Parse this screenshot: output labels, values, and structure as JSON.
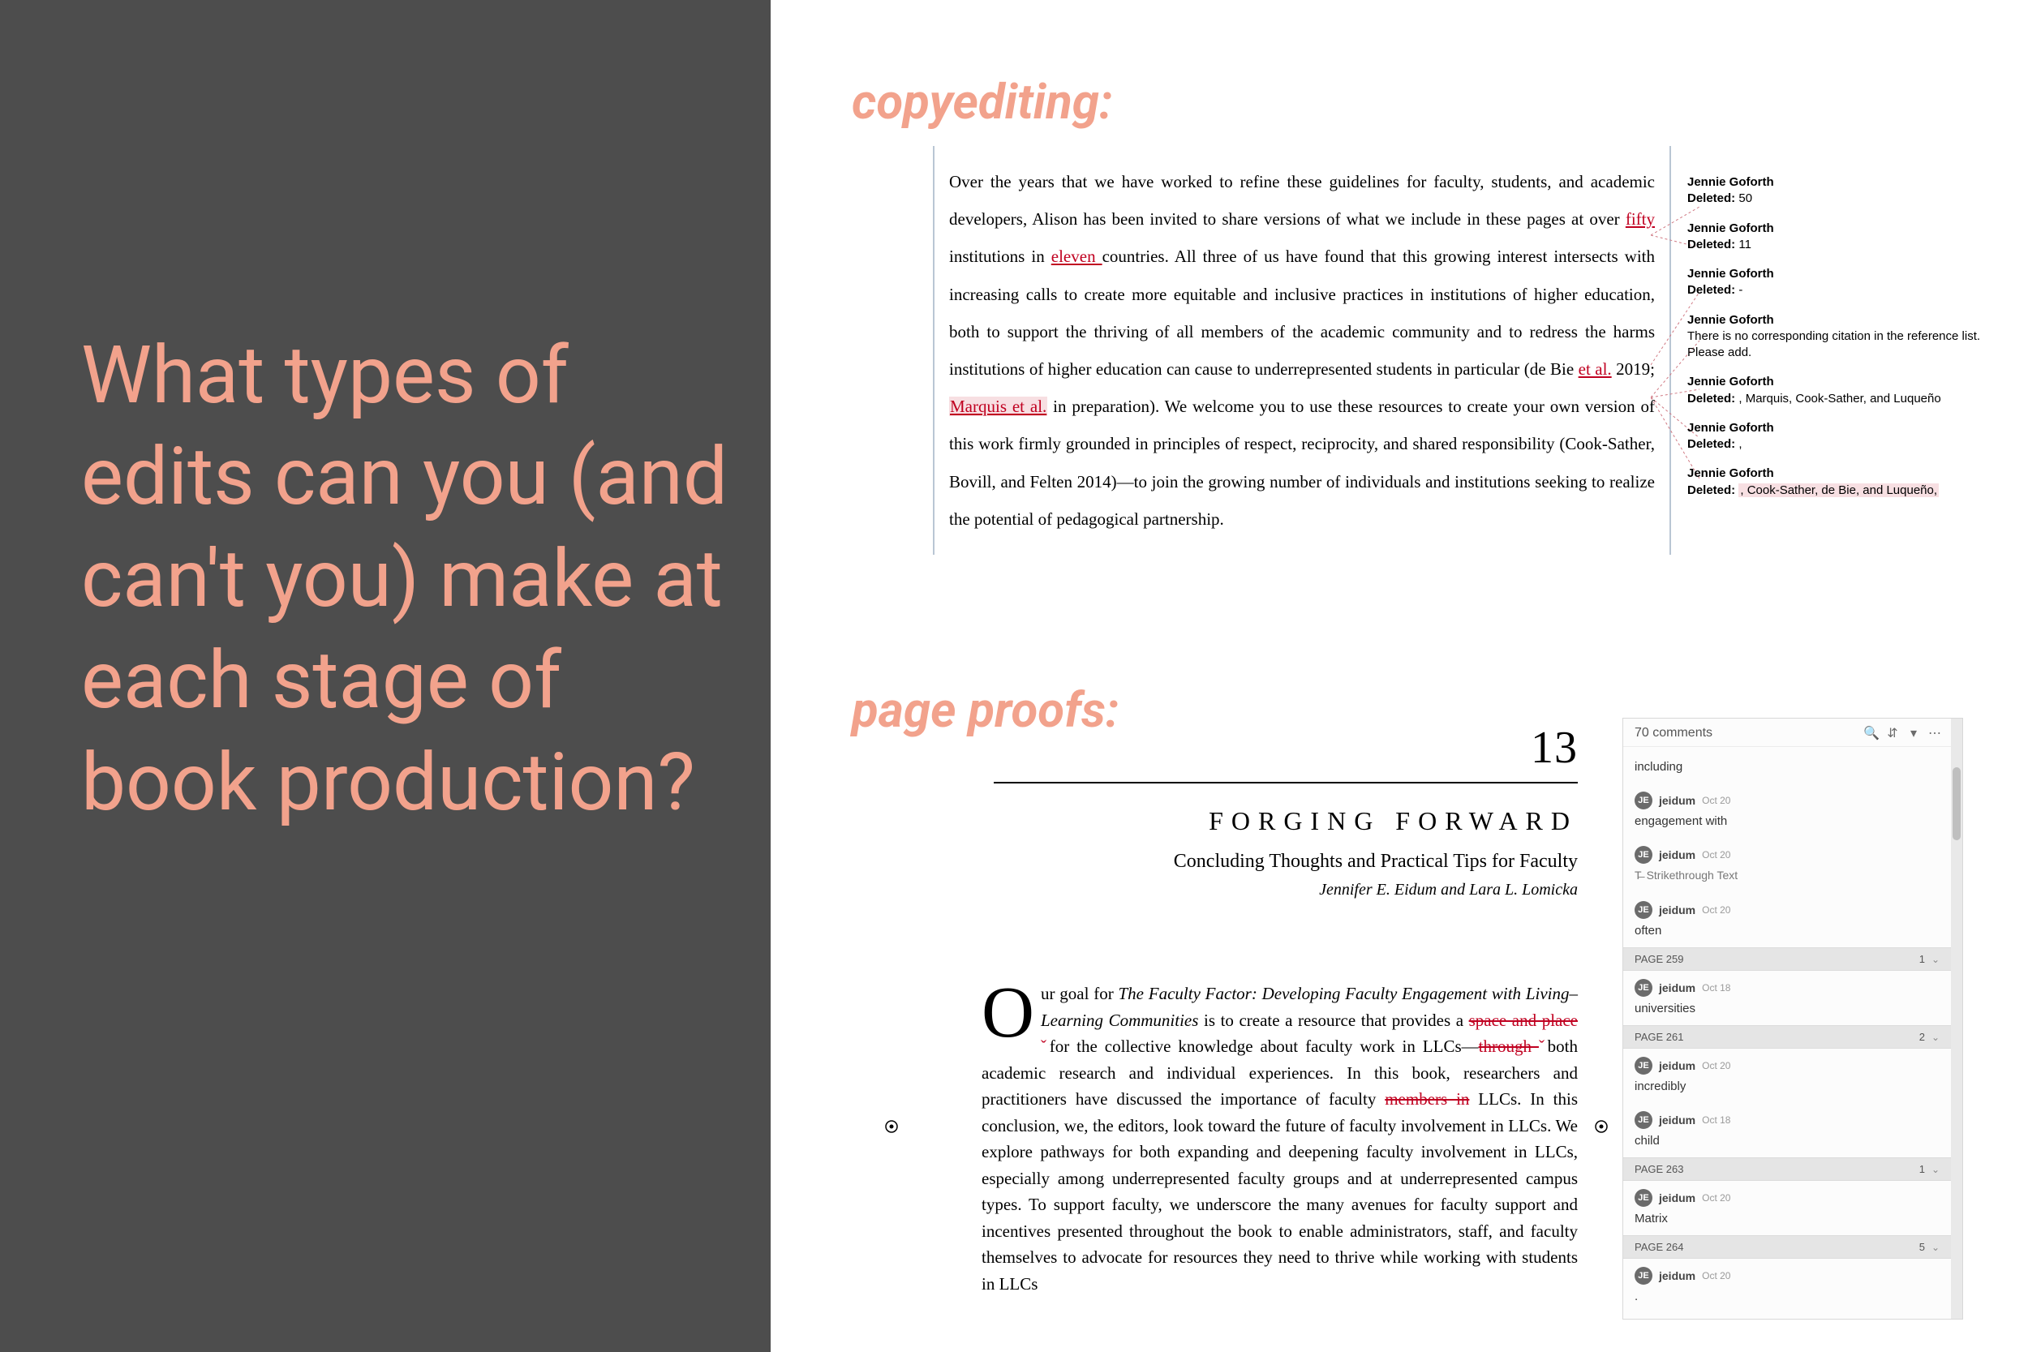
{
  "left": {
    "question": "What types of edits can you (and can't you) make at each stage of book production?"
  },
  "labels": {
    "copyediting": "copyediting:",
    "page_proofs": "page proofs:"
  },
  "manuscript": {
    "lead": "Over the years that we have worked to refine these guidelines for faculty, students, and academic developers, Alison has been invited to share versions of what we include in these pages at over ",
    "t1": "fifty ",
    "mid1": "institutions in ",
    "t2": "eleven ",
    "mid2": "countries. All three of us have found that this growing interest intersects with increasing calls to create more equitable and inclusive practices in institutions of higher education, both to support the thriving of all members of the academic community and to redress the harms institutions of higher education can cause to underrepresented students in particular (de Bie ",
    "t3": "et al.",
    "mid3": " 2019; ",
    "t4": "Marquis et al.",
    "tail": " in preparation). We welcome you to use these resources to create your own version of this work firmly grounded in principles of respect, reciprocity, and shared responsibility (Cook-Sather, Bovill, and Felten 2014)—to join the growing number of individuals and institutions seeking to realize the potential of pedagogical partnership."
  },
  "tracked": [
    {
      "who": "Jennie Goforth",
      "label": "Deleted:",
      "text": "50"
    },
    {
      "who": "Jennie Goforth",
      "label": "Deleted:",
      "text": "11"
    },
    {
      "who": "Jennie Goforth",
      "label": "Deleted:",
      "text": "-"
    },
    {
      "who": "Jennie Goforth",
      "label": "",
      "text": "There is no corresponding citation in the reference list. Please add."
    },
    {
      "who": "Jennie Goforth",
      "label": "Deleted:",
      "text": ", Marquis, Cook-Sather, and Luqueño"
    },
    {
      "who": "Jennie Goforth",
      "label": "Deleted:",
      "text": ","
    },
    {
      "who": "Jennie Goforth",
      "label": "Deleted:",
      "text": ", Cook-Sather, de Bie, and Luqueño,",
      "hl": true
    }
  ],
  "proof": {
    "num": "13",
    "title": "FORGING FORWARD",
    "sub": "Concluding Thoughts and Practical Tips for Faculty",
    "by": "Jennifer E. Eidum and Lara L. Lomicka",
    "drop": "O",
    "p1a": "ur goal for ",
    "p1it": "The Faculty Factor: Developing Faculty Engagement with Living–Learning Communities",
    "p1b": " is to create a resource that provides a ",
    "s1": "space and place ",
    "p1c": "for the collective knowledge about faculty work in LLCs—",
    "s2": "through ",
    "p1d": "both academic research and individual experiences. In this book, researchers and practitioners have discussed the importance of faculty ",
    "s3": "members in",
    "p1e": " LLCs. In this conclusion, we, the editors, look toward the future of faculty involvement in LLCs. We explore pathways for both expanding and deepening faculty involvement in LLCs, especially among underrepresented faculty groups and at underrepresented campus types. To support faculty, we underscore the many avenues for faculty support and incentives presented throughout the book to enable administrators, staff, and faculty themselves to advocate for resources they need to thrive while working with students in LLCs"
  },
  "pdf": {
    "header": "70 comments",
    "rows": [
      {
        "type": "text",
        "text": "including"
      },
      {
        "type": "cmt",
        "user": "jeidum",
        "date": "Oct 20",
        "text": "engagement with"
      },
      {
        "type": "cmt",
        "user": "jeidum",
        "date": "Oct 20",
        "strike": "Strikethrough Text"
      },
      {
        "type": "cmt",
        "user": "jeidum",
        "date": "Oct 20",
        "text": "often"
      },
      {
        "type": "page",
        "label": "PAGE 259",
        "count": "1"
      },
      {
        "type": "cmt",
        "user": "jeidum",
        "date": "Oct 18",
        "text": "universities"
      },
      {
        "type": "page",
        "label": "PAGE 261",
        "count": "2",
        "indicator": true
      },
      {
        "type": "cmt",
        "user": "jeidum",
        "date": "Oct 20",
        "text": "incredibly"
      },
      {
        "type": "cmt",
        "user": "jeidum",
        "date": "Oct 18",
        "text": "child"
      },
      {
        "type": "page",
        "label": "PAGE 263",
        "count": "1"
      },
      {
        "type": "cmt",
        "user": "jeidum",
        "date": "Oct 20",
        "text": "Matrix"
      },
      {
        "type": "page",
        "label": "PAGE 264",
        "count": "5"
      },
      {
        "type": "cmt",
        "user": "jeidum",
        "date": "Oct 20",
        "text": "."
      }
    ]
  }
}
